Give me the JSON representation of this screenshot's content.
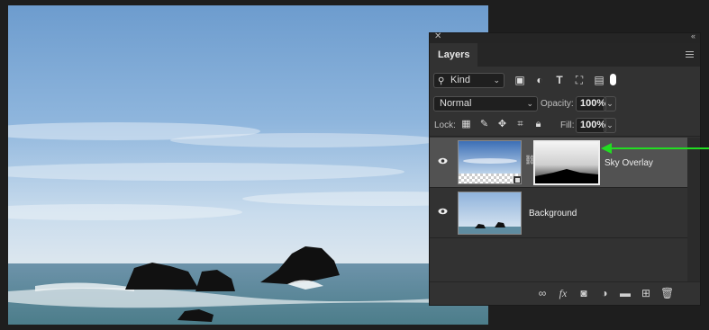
{
  "panel": {
    "tab_label": "Layers",
    "kind_label": "Kind",
    "blend_mode": "Normal",
    "opacity_label": "Opacity:",
    "opacity_value": "100%",
    "lock_label": "Lock:",
    "fill_label": "Fill:",
    "fill_value": "100%"
  },
  "layers": [
    {
      "name": "Sky Overlay",
      "selected": true,
      "has_mask": true
    },
    {
      "name": "Background",
      "selected": false,
      "has_mask": false
    }
  ],
  "icons": {
    "filter": [
      "image-filter-icon",
      "adjustment-filter-icon",
      "type-filter-icon",
      "shape-filter-icon",
      "smartobject-filter-icon"
    ],
    "lock": [
      "lock-pixels-icon",
      "lock-image-icon",
      "lock-position-icon",
      "lock-artboard-icon",
      "lock-all-icon"
    ],
    "bottom": [
      "link-layers-icon",
      "fx-icon",
      "add-mask-icon",
      "adjustment-layer-icon",
      "new-group-icon",
      "new-layer-icon",
      "trash-icon"
    ]
  },
  "colors": {
    "arrow": "#22dd22",
    "panel_bg": "#323232",
    "selected_row": "#525252"
  }
}
